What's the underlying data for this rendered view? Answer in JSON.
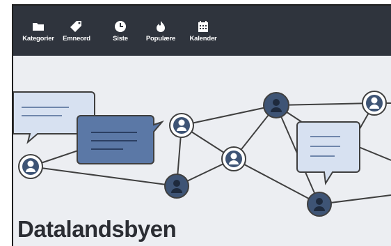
{
  "navbar": {
    "items": [
      {
        "label": "Kategorier",
        "icon": "folder-icon"
      },
      {
        "label": "Emneord",
        "icon": "tag-icon"
      },
      {
        "label": "Siste",
        "icon": "clock-icon"
      },
      {
        "label": "Populære",
        "icon": "fire-icon"
      },
      {
        "label": "Kalender",
        "icon": "calendar-icon"
      }
    ]
  },
  "hero": {
    "colors": {
      "background": "#eceef2",
      "node_dark": "#3e5475",
      "node_ring": "#ffffff",
      "bubble_dark": "#5b78a6",
      "bubble_light": "#d7e1f1",
      "line": "#3f3f3f"
    }
  },
  "page": {
    "title": "Datalandsbyen"
  }
}
